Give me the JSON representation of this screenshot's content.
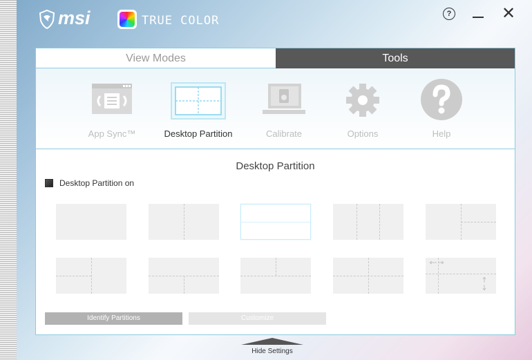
{
  "app": {
    "brand": "msi",
    "product": "TRUE COLOR",
    "help_glyph": "?",
    "minimize_glyph": "",
    "close_glyph": "✕"
  },
  "tabs": [
    {
      "label": "View Modes",
      "active": false
    },
    {
      "label": "Tools",
      "active": true
    }
  ],
  "tools": [
    {
      "label": "App Sync™",
      "icon": "app-sync-icon",
      "active": false
    },
    {
      "label": "Desktop Partition",
      "icon": "desktop-partition-icon",
      "active": true
    },
    {
      "label": "Calibrate",
      "icon": "calibrate-icon",
      "active": false
    },
    {
      "label": "Options",
      "icon": "gear-icon",
      "active": false
    },
    {
      "label": "Help",
      "icon": "help-icon",
      "active": false
    }
  ],
  "section": {
    "title": "Desktop Partition",
    "checkbox_label": "Desktop Partition on"
  },
  "layouts": [
    {
      "name": "layout-full",
      "selected": false
    },
    {
      "name": "layout-two-vertical",
      "selected": false
    },
    {
      "name": "layout-two-horizontal",
      "selected": true
    },
    {
      "name": "layout-three-vertical",
      "selected": false
    },
    {
      "name": "layout-right-split",
      "selected": false
    },
    {
      "name": "layout-left-split",
      "selected": false
    },
    {
      "name": "layout-bottom-split",
      "selected": false
    },
    {
      "name": "layout-top-split",
      "selected": false
    },
    {
      "name": "layout-quad",
      "selected": false
    },
    {
      "name": "layout-custom",
      "selected": false
    }
  ],
  "actions": {
    "identify": "Identify Partitions",
    "customize": "Customize"
  },
  "footer": {
    "hide_settings": "Hide Settings"
  },
  "colors": {
    "accent": "#8ccbe0",
    "tab_active_bg": "#585858",
    "button_gray": "#b2b2b2"
  }
}
